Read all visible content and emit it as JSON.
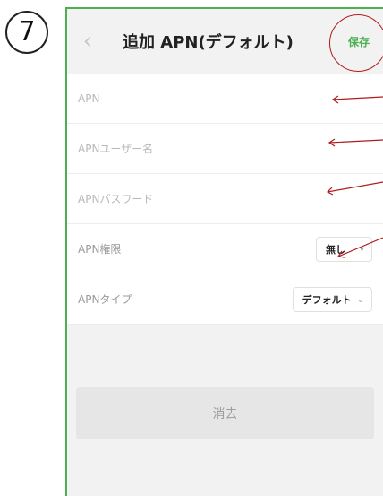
{
  "step_badge": "7",
  "header": {
    "back_icon": "chevron-left-icon",
    "title": "追加 APN(デフォルト)",
    "save_label": "保存"
  },
  "fields": [
    {
      "label": "APN",
      "value": "",
      "placeholder": ""
    },
    {
      "label": "APNユーザー名",
      "value": "",
      "placeholder": ""
    },
    {
      "label": "APNパスワード",
      "value": "",
      "placeholder": ""
    }
  ],
  "selects": {
    "auth": {
      "label": "APN権限",
      "value": "無し"
    },
    "type": {
      "label": "APNタイプ",
      "value": "デフォルト"
    }
  },
  "delete_label": "消去",
  "colors": {
    "accent": "#4caf50",
    "annotation": "#b01c1c",
    "background": "#f2f2f2"
  }
}
